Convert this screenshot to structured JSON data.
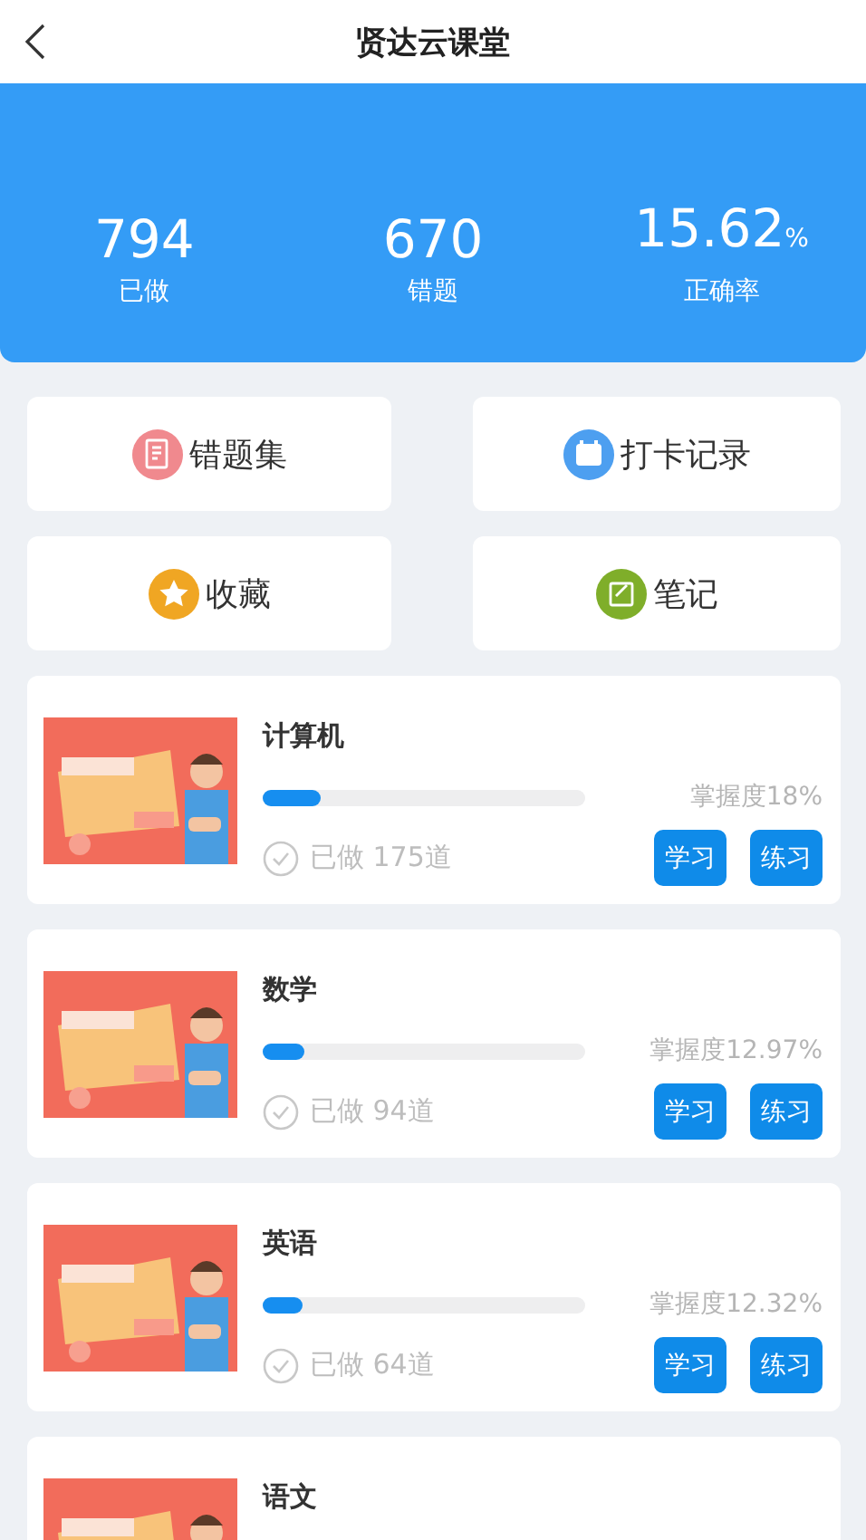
{
  "header": {
    "title": "贤达云课堂"
  },
  "stats": [
    {
      "value": "794",
      "label": "已做"
    },
    {
      "value": "670",
      "label": "错题"
    },
    {
      "value": "15.62",
      "unit": "%",
      "label": "正确率"
    }
  ],
  "shortcuts": [
    {
      "label": "错题集",
      "kind": "list",
      "color": "#f0898e"
    },
    {
      "label": "打卡记录",
      "kind": "calendar",
      "color": "#4d9ff0"
    },
    {
      "label": "收藏",
      "kind": "star",
      "color": "#f0a623"
    },
    {
      "label": "笔记",
      "kind": "note",
      "color": "#7fae2a"
    }
  ],
  "courses": [
    {
      "title": "计算机",
      "level": 0.18,
      "mastery": "掌握度18%",
      "done": "已做 175道",
      "buttons": [
        "学习",
        "练习"
      ]
    },
    {
      "title": "数学",
      "level": 0.1297,
      "mastery": "掌握度12.97%",
      "done": "已做 94道",
      "buttons": [
        "学习",
        "练习"
      ]
    },
    {
      "title": "英语",
      "level": 0.1232,
      "mastery": "掌握度12.32%",
      "done": "已做 64道",
      "buttons": [
        "学习",
        "练习"
      ]
    },
    {
      "title": "语文"
    }
  ]
}
